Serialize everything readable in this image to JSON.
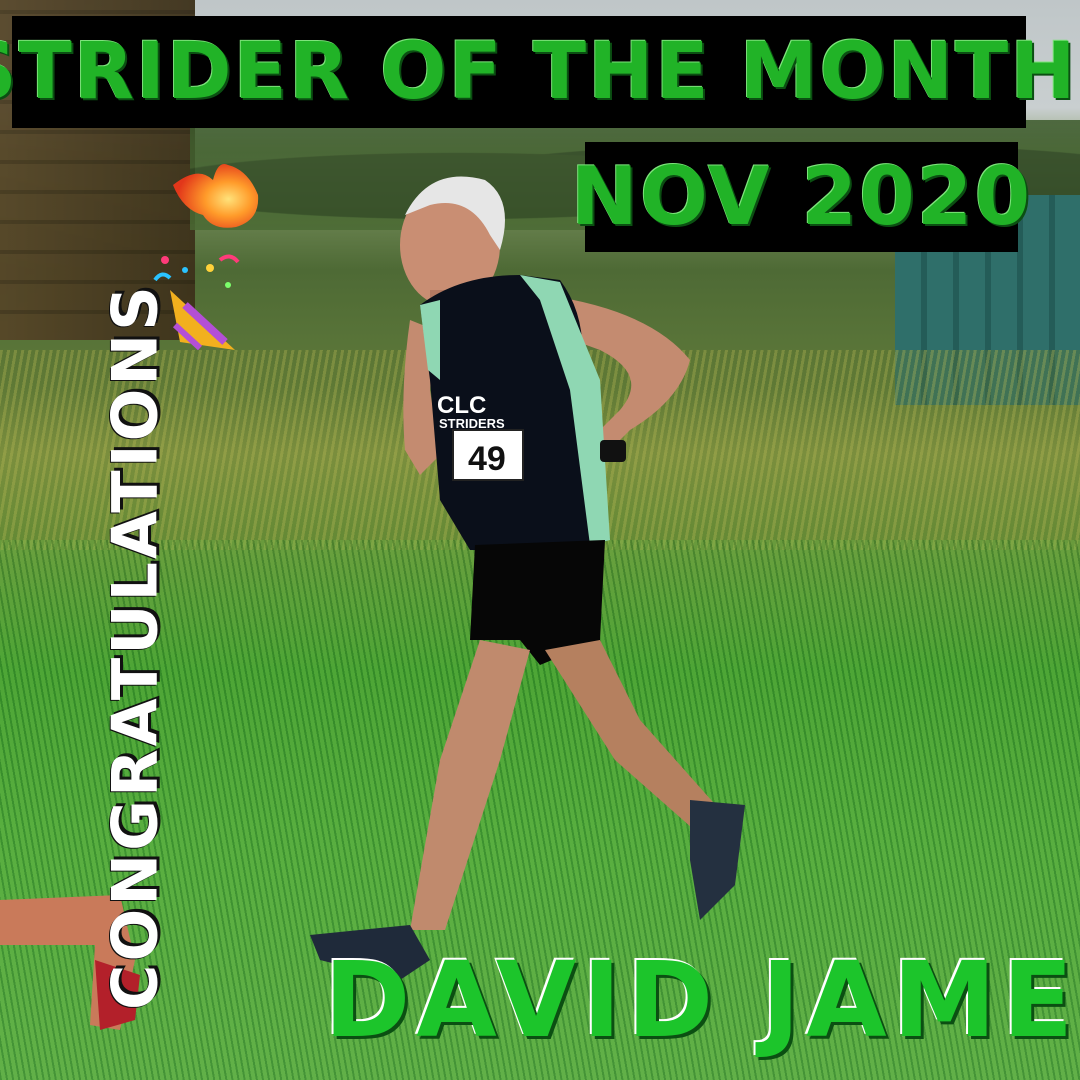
{
  "poster": {
    "headline": "STRIDER OF THE MONTH",
    "month": "NOV 2020",
    "name": "DAVID JAMES",
    "congrats": "CONGRATULATIONS",
    "accent_color": "#21b327",
    "bar_color": "#000000"
  },
  "runner": {
    "vest_text": "CLC",
    "vest_subtext": "STRIDERS",
    "bib_number": "49"
  },
  "icons": {
    "fire": "fire-icon",
    "party": "party-popper-icon"
  }
}
